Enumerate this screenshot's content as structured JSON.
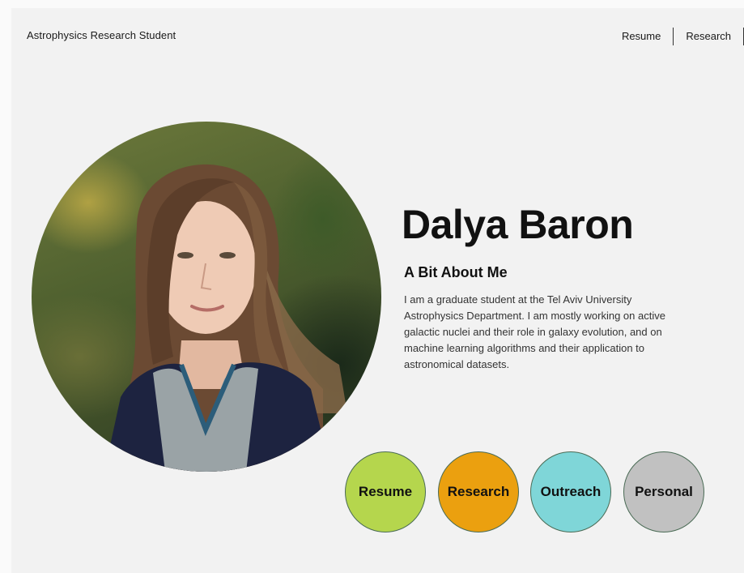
{
  "header": {
    "site_title": "Astrophysics Research Student",
    "nav": [
      {
        "label": "Resume"
      },
      {
        "label": "Research"
      }
    ]
  },
  "profile": {
    "portrait_icon": "portrait-photo",
    "name": "Dalya Baron",
    "about_heading": "A Bit About Me",
    "about_text": "I am a graduate student at the Tel Aviv University Astrophysics Department. I am mostly working on active galactic nuclei and their role in galaxy evolution, and on machine learning algorithms and their application to astronomical datasets."
  },
  "sections": [
    {
      "label": "Resume",
      "color": "#b5d64d"
    },
    {
      "label": "Research",
      "color": "#eba00f"
    },
    {
      "label": "Outreach",
      "color": "#7fd6d8"
    },
    {
      "label": "Personal",
      "color": "#c1c1c1"
    }
  ]
}
